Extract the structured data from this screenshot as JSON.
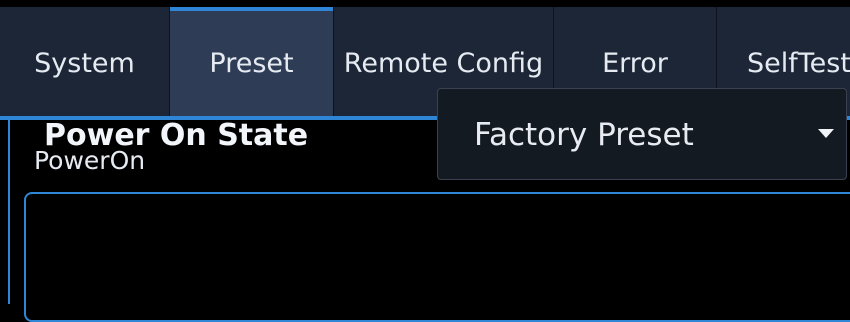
{
  "tabs": [
    {
      "label": "System",
      "active": false
    },
    {
      "label": "Preset",
      "active": true
    },
    {
      "label": "Remote Config",
      "active": false
    },
    {
      "label": "Error",
      "active": false
    },
    {
      "label": "SelfTest",
      "active": false
    }
  ],
  "section": {
    "title": "PowerOn"
  },
  "power_on_state": {
    "label": "Power On State",
    "value": "Factory Preset",
    "caret_icon": "caret-down-icon"
  },
  "colors": {
    "accent": "#2f86d6",
    "tab_bg": "#1c2636",
    "tab_active_bg": "#2e3d55",
    "dropdown_bg": "#141a22",
    "background": "#000000"
  }
}
